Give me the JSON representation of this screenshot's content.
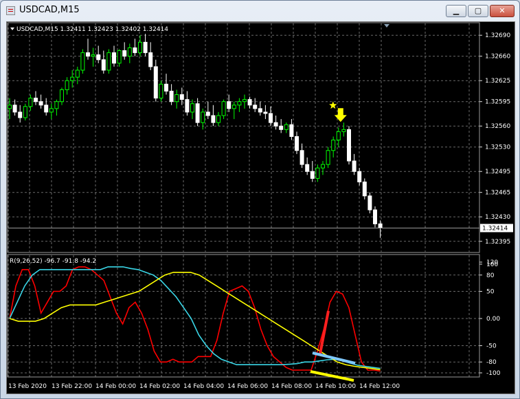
{
  "window": {
    "title": "USDCAD,M15",
    "min_glyph": "▁",
    "max_glyph": "▢",
    "close_glyph": "✕"
  },
  "colors": {
    "background": "#000000",
    "bull_candle": "#00ff00",
    "bear_candle": "#ffffff",
    "grid": "#6b6b6b",
    "signal_arrow": "#ffff00",
    "oscillator_fast": "#ff0000",
    "oscillator_mid": "#3ad7e8",
    "oscillator_slow": "#ffff00",
    "trend_red": "#ff2020",
    "trend_blue": "#7fc8ff",
    "trend_yellow": "#ffff00"
  },
  "price_panel": {
    "header": "USDCAD,M15  1.32411 1.32423 1.32402 1.32414",
    "y_ticks": [
      "1.32690",
      "1.32660",
      "1.32625",
      "1.32595",
      "1.32560",
      "1.32530",
      "1.32495",
      "1.32465",
      "1.32430",
      "1.32395"
    ],
    "current_price": "1.32414",
    "ylim": [
      1.3238,
      1.32705
    ]
  },
  "indicator_panel": {
    "header": "R(9,26,52) -96.7 -91.8 -94.2",
    "y_ticks": [
      "120",
      "100",
      "80",
      "50",
      "0.00",
      "-50",
      "-80",
      "-100"
    ]
  },
  "x_ticks": [
    "13 Feb 2020",
    "13 Feb 22:00",
    "14 Feb 00:00",
    "14 Feb 02:00",
    "14 Feb 04:00",
    "14 Feb 06:00",
    "14 Feb 08:00",
    "14 Feb 10:00",
    "14 Feb 12:00"
  ],
  "chart_data": {
    "type": "candlestick",
    "series_ohlc": [
      [
        1.32585,
        1.326,
        1.3257,
        1.3259
      ],
      [
        1.3259,
        1.32598,
        1.32575,
        1.3258
      ],
      [
        1.3258,
        1.3259,
        1.32565,
        1.32572
      ],
      [
        1.32572,
        1.32592,
        1.32568,
        1.32588
      ],
      [
        1.32588,
        1.32605,
        1.32582,
        1.326
      ],
      [
        1.326,
        1.3261,
        1.3259,
        1.32595
      ],
      [
        1.32595,
        1.32605,
        1.32585,
        1.3259
      ],
      [
        1.3259,
        1.326,
        1.32575,
        1.3258
      ],
      [
        1.3258,
        1.32592,
        1.3257,
        1.32585
      ],
      [
        1.32585,
        1.32598,
        1.32575,
        1.32595
      ],
      [
        1.32595,
        1.32615,
        1.3259,
        1.32612
      ],
      [
        1.32612,
        1.3263,
        1.32605,
        1.32625
      ],
      [
        1.32625,
        1.3264,
        1.32615,
        1.3263
      ],
      [
        1.3263,
        1.32645,
        1.3262,
        1.3264
      ],
      [
        1.3264,
        1.3267,
        1.32635,
        1.32665
      ],
      [
        1.32665,
        1.32685,
        1.32655,
        1.3266
      ],
      [
        1.3266,
        1.32672,
        1.32645,
        1.32662
      ],
      [
        1.32662,
        1.32675,
        1.3265,
        1.32655
      ],
      [
        1.32655,
        1.32668,
        1.32635,
        1.3264
      ],
      [
        1.3264,
        1.3267,
        1.32635,
        1.32665
      ],
      [
        1.32665,
        1.32675,
        1.32645,
        1.3265
      ],
      [
        1.3265,
        1.3267,
        1.32645,
        1.32668
      ],
      [
        1.32668,
        1.3268,
        1.32655,
        1.3266
      ],
      [
        1.3266,
        1.32678,
        1.3265,
        1.32672
      ],
      [
        1.32672,
        1.32685,
        1.3266,
        1.32665
      ],
      [
        1.32665,
        1.3269,
        1.3266,
        1.3268
      ],
      [
        1.3268,
        1.32692,
        1.3266,
        1.32665
      ],
      [
        1.32665,
        1.3268,
        1.3264,
        1.32645
      ],
      [
        1.32645,
        1.32655,
        1.32595,
        1.326
      ],
      [
        1.326,
        1.32625,
        1.32595,
        1.3262
      ],
      [
        1.3262,
        1.32635,
        1.32605,
        1.3261
      ],
      [
        1.3261,
        1.3262,
        1.3259,
        1.32595
      ],
      [
        1.32595,
        1.32612,
        1.32585,
        1.32605
      ],
      [
        1.32605,
        1.32615,
        1.3259,
        1.32598
      ],
      [
        1.32598,
        1.3261,
        1.32575,
        1.3258
      ],
      [
        1.3258,
        1.32598,
        1.3257,
        1.32592
      ],
      [
        1.32592,
        1.326,
        1.3256,
        1.32565
      ],
      [
        1.32565,
        1.32585,
        1.32555,
        1.3258
      ],
      [
        1.3258,
        1.32595,
        1.3257,
        1.32575
      ],
      [
        1.32575,
        1.3259,
        1.3256,
        1.32565
      ],
      [
        1.32565,
        1.3258,
        1.3256,
        1.32575
      ],
      [
        1.32575,
        1.32598,
        1.3257,
        1.32595
      ],
      [
        1.32595,
        1.32605,
        1.3258,
        1.32585
      ],
      [
        1.32585,
        1.32595,
        1.3257,
        1.3259
      ],
      [
        1.3259,
        1.326,
        1.3258,
        1.32595
      ],
      [
        1.32595,
        1.32605,
        1.32585,
        1.32598
      ],
      [
        1.32598,
        1.32602,
        1.32585,
        1.3259
      ],
      [
        1.3259,
        1.326,
        1.3258,
        1.32585
      ],
      [
        1.32585,
        1.32595,
        1.32575,
        1.3258
      ],
      [
        1.3258,
        1.3259,
        1.3257,
        1.32578
      ],
      [
        1.32578,
        1.32588,
        1.3256,
        1.32565
      ],
      [
        1.32565,
        1.32575,
        1.32555,
        1.3256
      ],
      [
        1.3256,
        1.3257,
        1.3255,
        1.32555
      ],
      [
        1.32555,
        1.32565,
        1.3255,
        1.32562
      ],
      [
        1.32562,
        1.3257,
        1.3254,
        1.32545
      ],
      [
        1.32545,
        1.32552,
        1.3252,
        1.32525
      ],
      [
        1.32525,
        1.32535,
        1.325,
        1.32505
      ],
      [
        1.32505,
        1.32515,
        1.3249,
        1.32495
      ],
      [
        1.32495,
        1.3251,
        1.3248,
        1.32485
      ],
      [
        1.32485,
        1.32505,
        1.3248,
        1.325
      ],
      [
        1.325,
        1.3251,
        1.3249,
        1.32505
      ],
      [
        1.32505,
        1.3253,
        1.325,
        1.32525
      ],
      [
        1.32525,
        1.32545,
        1.32515,
        1.3254
      ],
      [
        1.3254,
        1.32558,
        1.3253,
        1.32552
      ],
      [
        1.32552,
        1.32565,
        1.32545,
        1.32555
      ],
      [
        1.32555,
        1.3256,
        1.32505,
        1.3251
      ],
      [
        1.3251,
        1.3252,
        1.3249,
        1.32495
      ],
      [
        1.32495,
        1.325,
        1.32475,
        1.3248
      ],
      [
        1.3248,
        1.32485,
        1.32455,
        1.3246
      ],
      [
        1.3246,
        1.32465,
        1.32435,
        1.3244
      ],
      [
        1.3244,
        1.32445,
        1.32415,
        1.3242
      ],
      [
        1.3242,
        1.32425,
        1.324,
        1.32414
      ]
    ],
    "signal_index": 63
  }
}
